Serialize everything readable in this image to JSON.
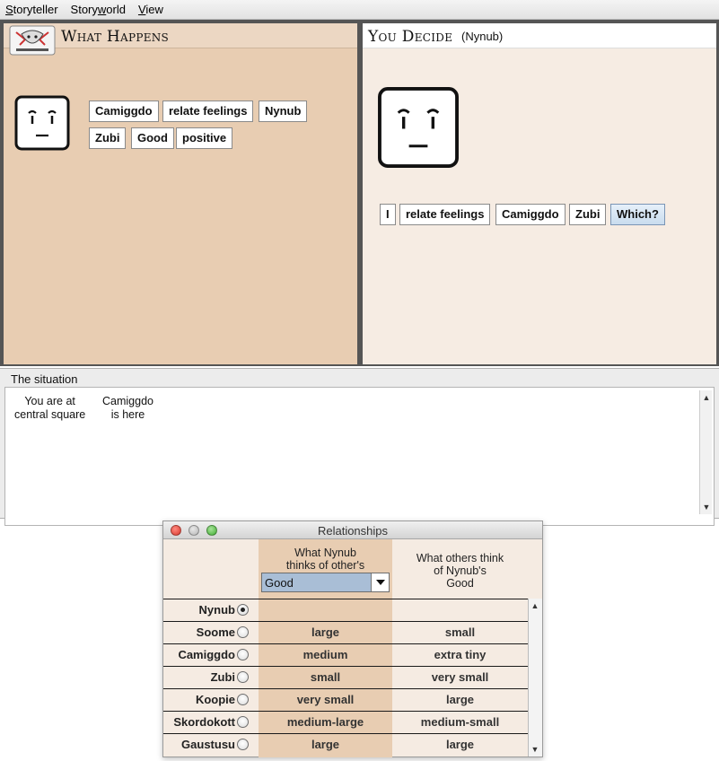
{
  "menu": {
    "items": [
      "Storyteller",
      "Storyworld",
      "View"
    ]
  },
  "left_pane": {
    "title": "What Happens",
    "words": [
      "Camiggdo",
      "relate feelings",
      "Nynub",
      "Zubi",
      "Good",
      "positive"
    ]
  },
  "right_pane": {
    "title": "You Decide",
    "subtitle": "(Nynub)",
    "words": [
      "I",
      "relate feelings",
      "Camiggdo",
      "Zubi",
      "Which?"
    ]
  },
  "situation": {
    "title": "The situation",
    "location": [
      "You are at",
      "central square"
    ],
    "present": [
      "Camiggdo",
      "is here"
    ]
  },
  "relationships": {
    "window_title": "Relationships",
    "col1_header": [
      "What Nynub",
      "thinks of other's"
    ],
    "col2_header": [
      "What others think",
      "of Nynub's",
      "Good"
    ],
    "selected_trait": "Good",
    "rows": [
      {
        "name": "Nynub",
        "selected": true,
        "thinks": "",
        "others": ""
      },
      {
        "name": "Soome",
        "selected": false,
        "thinks": "large",
        "others": "small"
      },
      {
        "name": "Camiggdo",
        "selected": false,
        "thinks": "medium",
        "others": "extra tiny"
      },
      {
        "name": "Zubi",
        "selected": false,
        "thinks": "small",
        "others": "very small"
      },
      {
        "name": "Koopie",
        "selected": false,
        "thinks": "very small",
        "others": "large"
      },
      {
        "name": "Skordokott",
        "selected": false,
        "thinks": "medium-large",
        "others": "medium-small"
      },
      {
        "name": "Gaustusu",
        "selected": false,
        "thinks": "large",
        "others": "large"
      }
    ]
  },
  "icons": {
    "face": "neutral-face-icon",
    "logo": "storyworld-logo-icon"
  }
}
